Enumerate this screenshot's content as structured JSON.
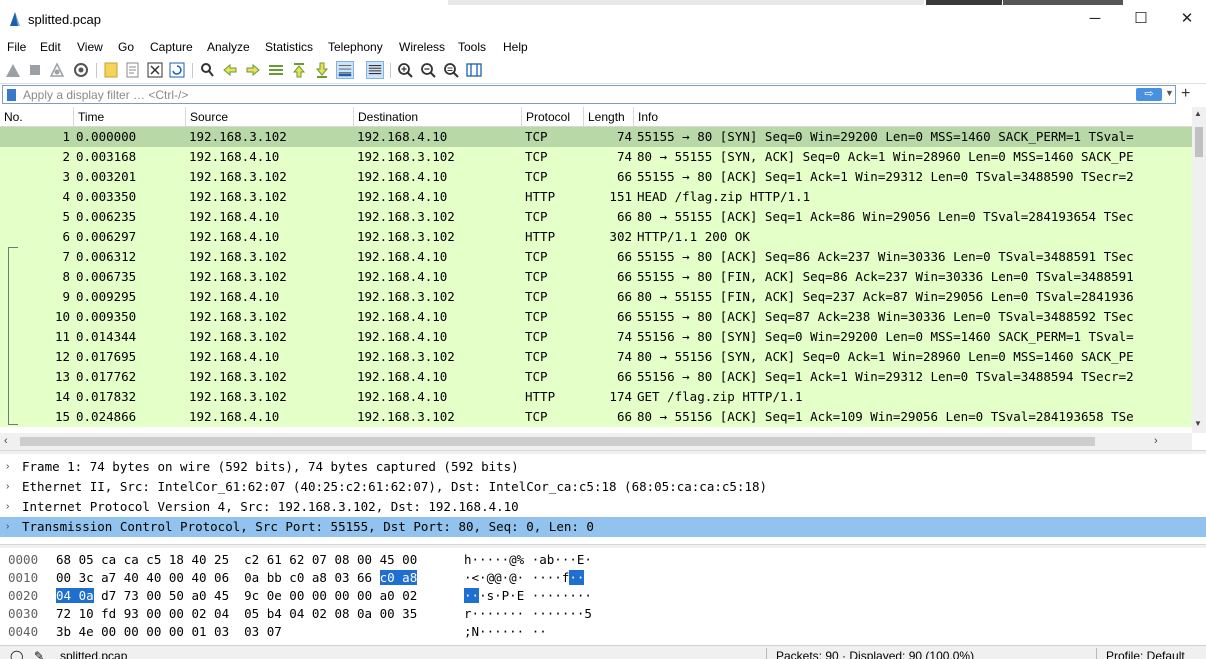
{
  "window": {
    "title": "splitted.pcap",
    "minimize_label": "─",
    "maximize_label": "☐",
    "close_label": "✕"
  },
  "menu": [
    "File",
    "Edit",
    "View",
    "Go",
    "Capture",
    "Analyze",
    "Statistics",
    "Telephony",
    "Wireless",
    "Tools",
    "Help"
  ],
  "toolbar_icons": [
    "start-capture-icon",
    "stop-capture-icon",
    "restart-capture-icon",
    "capture-options-icon",
    "open-file-icon",
    "save-file-icon",
    "close-file-icon",
    "reload-file-icon",
    "find-packet-icon",
    "go-back-icon",
    "go-forward-icon",
    "go-to-packet-icon",
    "go-first-icon",
    "go-last-icon",
    "autoscroll-icon",
    "colorize-icon",
    "zoom-in-icon",
    "zoom-out-icon",
    "zoom-reset-icon",
    "resize-columns-icon"
  ],
  "filter": {
    "placeholder": "Apply a display filter … <Ctrl-/>",
    "apply_label": "⇨"
  },
  "columns": {
    "no": "No.",
    "time": "Time",
    "source": "Source",
    "destination": "Destination",
    "protocol": "Protocol",
    "length": "Length",
    "info": "Info"
  },
  "packets": [
    {
      "no": "1",
      "time": "0.000000",
      "src": "192.168.3.102",
      "dst": "192.168.4.10",
      "proto": "TCP",
      "len": "74",
      "info": "55155 → 80 [SYN] Seq=0 Win=29200 Len=0 MSS=1460 SACK_PERM=1 TSval="
    },
    {
      "no": "2",
      "time": "0.003168",
      "src": "192.168.4.10",
      "dst": "192.168.3.102",
      "proto": "TCP",
      "len": "74",
      "info": "80 → 55155 [SYN, ACK] Seq=0 Ack=1 Win=28960 Len=0 MSS=1460 SACK_PE"
    },
    {
      "no": "3",
      "time": "0.003201",
      "src": "192.168.3.102",
      "dst": "192.168.4.10",
      "proto": "TCP",
      "len": "66",
      "info": "55155 → 80 [ACK] Seq=1 Ack=1 Win=29312 Len=0 TSval=3488590 TSecr=2"
    },
    {
      "no": "4",
      "time": "0.003350",
      "src": "192.168.3.102",
      "dst": "192.168.4.10",
      "proto": "HTTP",
      "len": "151",
      "info": "HEAD /flag.zip HTTP/1.1"
    },
    {
      "no": "5",
      "time": "0.006235",
      "src": "192.168.4.10",
      "dst": "192.168.3.102",
      "proto": "TCP",
      "len": "66",
      "info": "80 → 55155 [ACK] Seq=1 Ack=86 Win=29056 Len=0 TSval=284193654 TSec"
    },
    {
      "no": "6",
      "time": "0.006297",
      "src": "192.168.4.10",
      "dst": "192.168.3.102",
      "proto": "HTTP",
      "len": "302",
      "info": "HTTP/1.1 200 OK"
    },
    {
      "no": "7",
      "time": "0.006312",
      "src": "192.168.3.102",
      "dst": "192.168.4.10",
      "proto": "TCP",
      "len": "66",
      "info": "55155 → 80 [ACK] Seq=86 Ack=237 Win=30336 Len=0 TSval=3488591 TSec"
    },
    {
      "no": "8",
      "time": "0.006735",
      "src": "192.168.3.102",
      "dst": "192.168.4.10",
      "proto": "TCP",
      "len": "66",
      "info": "55155 → 80 [FIN, ACK] Seq=86 Ack=237 Win=30336 Len=0 TSval=3488591"
    },
    {
      "no": "9",
      "time": "0.009295",
      "src": "192.168.4.10",
      "dst": "192.168.3.102",
      "proto": "TCP",
      "len": "66",
      "info": "80 → 55155 [FIN, ACK] Seq=237 Ack=87 Win=29056 Len=0 TSval=2841936"
    },
    {
      "no": "10",
      "time": "0.009350",
      "src": "192.168.3.102",
      "dst": "192.168.4.10",
      "proto": "TCP",
      "len": "66",
      "info": "55155 → 80 [ACK] Seq=87 Ack=238 Win=30336 Len=0 TSval=3488592 TSec"
    },
    {
      "no": "11",
      "time": "0.014344",
      "src": "192.168.3.102",
      "dst": "192.168.4.10",
      "proto": "TCP",
      "len": "74",
      "info": "55156 → 80 [SYN] Seq=0 Win=29200 Len=0 MSS=1460 SACK_PERM=1 TSval="
    },
    {
      "no": "12",
      "time": "0.017695",
      "src": "192.168.4.10",
      "dst": "192.168.3.102",
      "proto": "TCP",
      "len": "74",
      "info": "80 → 55156 [SYN, ACK] Seq=0 Ack=1 Win=28960 Len=0 MSS=1460 SACK_PE"
    },
    {
      "no": "13",
      "time": "0.017762",
      "src": "192.168.3.102",
      "dst": "192.168.4.10",
      "proto": "TCP",
      "len": "66",
      "info": "55156 → 80 [ACK] Seq=1 Ack=1 Win=29312 Len=0 TSval=3488594 TSecr=2"
    },
    {
      "no": "14",
      "time": "0.017832",
      "src": "192.168.3.102",
      "dst": "192.168.4.10",
      "proto": "HTTP",
      "len": "174",
      "info": "GET /flag.zip HTTP/1.1"
    },
    {
      "no": "15",
      "time": "0.024866",
      "src": "192.168.4.10",
      "dst": "192.168.3.102",
      "proto": "TCP",
      "len": "66",
      "info": "80 → 55156 [ACK] Seq=1 Ack=109 Win=29056 Len=0 TSval=284193658 TSe"
    }
  ],
  "details": [
    {
      "text": "Frame 1: 74 bytes on wire (592 bits), 74 bytes captured (592 bits)",
      "selected": false
    },
    {
      "text": "Ethernet II, Src: IntelCor_61:62:07 (40:25:c2:61:62:07), Dst: IntelCor_ca:c5:18 (68:05:ca:ca:c5:18)",
      "selected": false
    },
    {
      "text": "Internet Protocol Version 4, Src: 192.168.3.102, Dst: 192.168.4.10",
      "selected": false
    },
    {
      "text": "Transmission Control Protocol, Src Port: 55155, Dst Port: 80, Seq: 0, Len: 0",
      "selected": true
    }
  ],
  "bytes": [
    {
      "offset": "0000",
      "hex_a": "68 05 ca ca c5 18 40 25  c2 61 62 07 08 00 45 00",
      "hex_hl": "",
      "hex_b": "",
      "asc_hl": "",
      "asc": "h·····@% ·ab···E·"
    },
    {
      "offset": "0010",
      "hex_a": "00 3c a7 40 40 00 40 06  0a bb c0 a8 03 66 ",
      "hex_hl": "c0 a8",
      "hex_b": "",
      "asc": "·<·@@·@· ····f",
      "asc_hl": "··"
    },
    {
      "offset": "0020",
      "hex_a": "",
      "hex_hl": "04 0a",
      "hex_b": " d7 73 00 50 a0 45  9c 0e 00 00 00 00 a0 02",
      "asc_hl": "··",
      "asc": "·s·P·E ········"
    },
    {
      "offset": "0030",
      "hex_a": "72 10 fd 93 00 00 02 04  05 b4 04 02 08 0a 00 35",
      "hex_hl": "",
      "hex_b": "",
      "asc_hl": "",
      "asc": "r······· ·······5"
    },
    {
      "offset": "0040",
      "hex_a": "3b 4e 00 00 00 00 01 03  03 07",
      "hex_hl": "",
      "hex_b": "",
      "asc_hl": "",
      "asc": ";N······ ··"
    }
  ],
  "status": {
    "file": "splitted.pcap",
    "packets": "Packets: 90 · Displayed: 90 (100.0%)",
    "profile": "Profile: Default"
  }
}
